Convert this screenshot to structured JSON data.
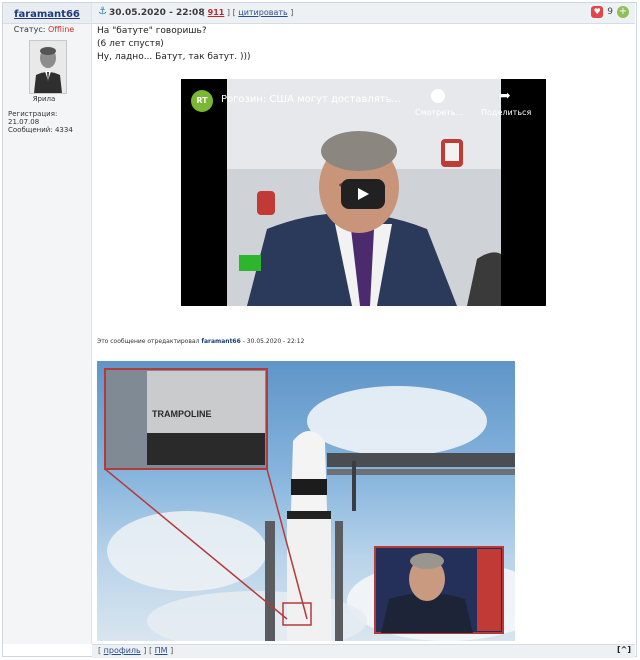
{
  "author": {
    "username": "faramant66",
    "status_label": "Статус:",
    "status_value": "Offline",
    "avatar_caption": "Ярила",
    "reg_label": "Регистрация:",
    "reg_date": "21.07.08",
    "posts_label": "Сообщений:",
    "posts_count": "4334"
  },
  "post": {
    "date": "30.05.2020 - 22:08",
    "number": "911",
    "quote_label": "цитировать",
    "likes": "9",
    "lines": [
      "На \"батуте\" говоришь?",
      "(6 лет спустя)",
      "Ну, ладно... Батут, так батут. )))"
    ],
    "edited_prefix": "Это сообщение отредактировал",
    "edited_user": "faramant66",
    "edited_suffix": "- 30.05.2020 - 22:12"
  },
  "video": {
    "channel_logo": "RT",
    "title": "Рогозин: США могут доставлять...",
    "watch_label": "Смотреть...",
    "share_label": "Поделиться",
    "screen_logo": "RT"
  },
  "photo": {
    "trampoline_text": "TRAMPOLINE"
  },
  "footer": {
    "profile_label": "профиль",
    "pm_label": "ПМ",
    "top_label": "[^]"
  }
}
